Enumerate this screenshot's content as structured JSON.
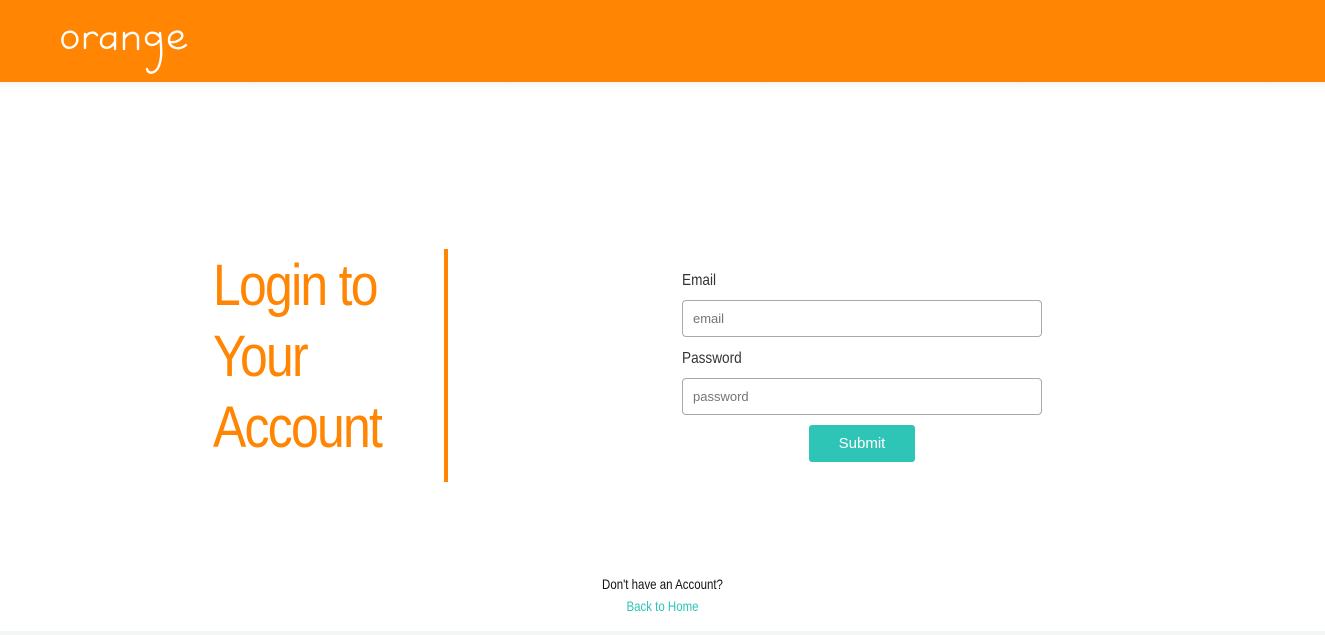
{
  "header": {
    "logo_text": "orange",
    "background_color": "#ff8502",
    "logo_color": "#ffffff"
  },
  "login_heading": {
    "lines": [
      "Login to",
      "Your",
      "Account"
    ],
    "color": "#ff8502"
  },
  "form": {
    "email_label": "Email",
    "email_placeholder": "email",
    "password_label": "Password",
    "password_placeholder": "password",
    "submit_label": "Submit",
    "submit_color": "#2ec4b6"
  },
  "footer": {
    "no_account_text": "Don't have an Account?",
    "back_home_link": "Back to Home",
    "link_color": "#2ec4b6"
  }
}
